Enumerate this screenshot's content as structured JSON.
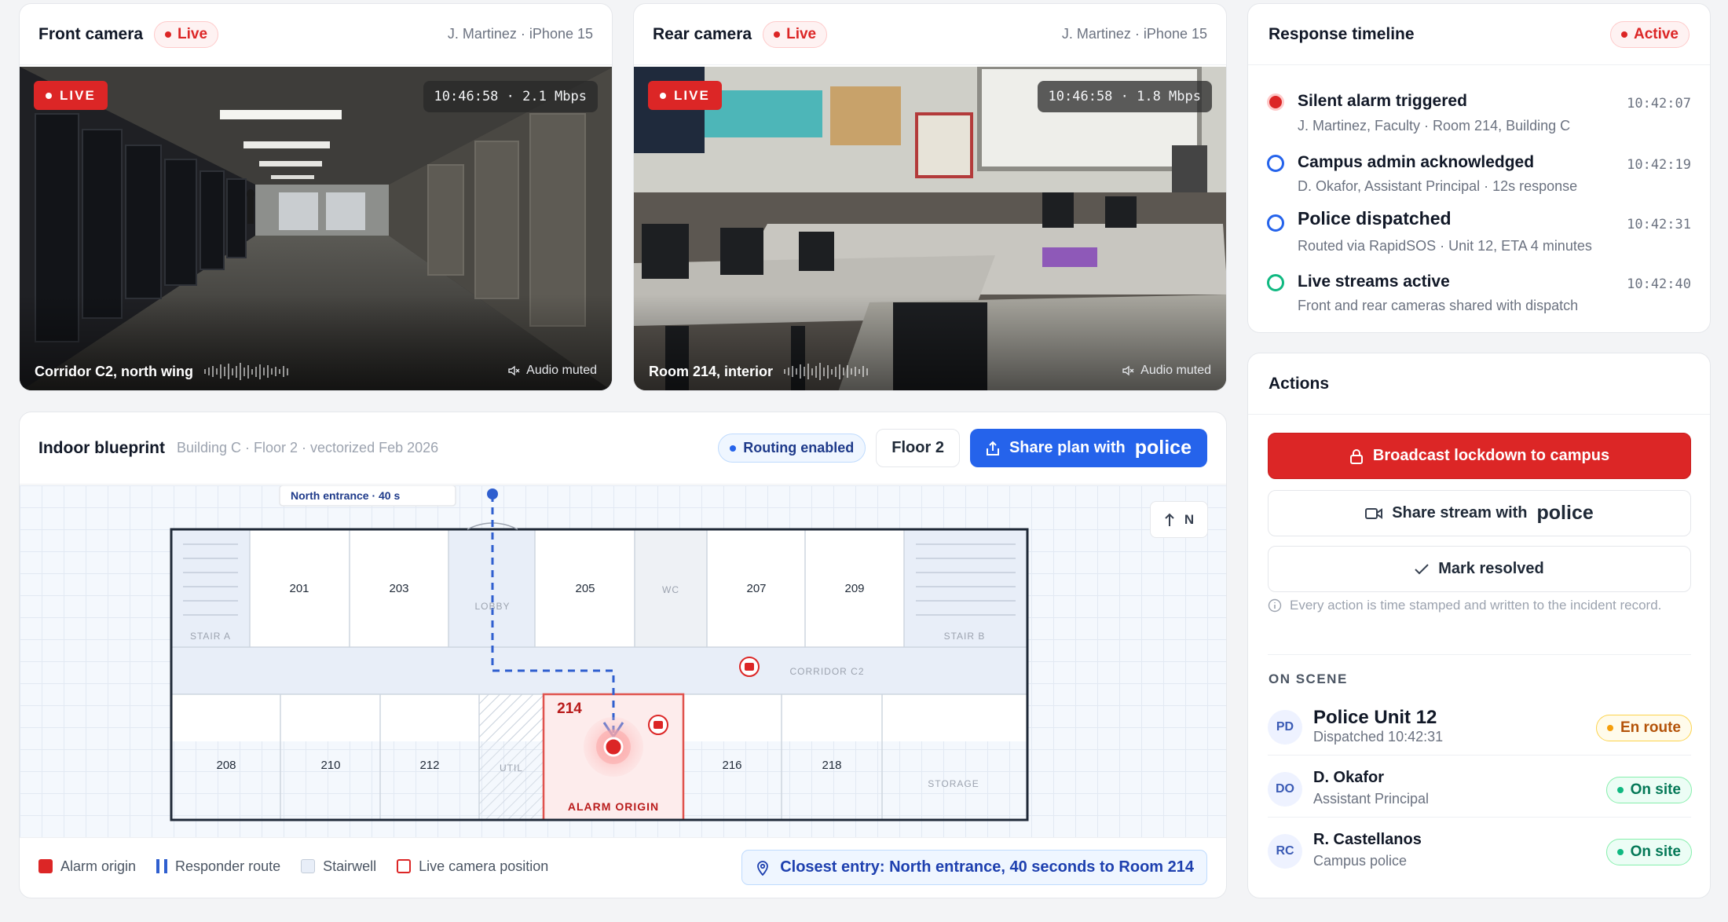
{
  "front_camera": {
    "title": "Front camera",
    "status": "Live",
    "owner": "J. Martinez · iPhone 15",
    "badge": "LIVE",
    "stats": "10:46:58 · 2.1 Mbps",
    "caption": "Corridor C2, north wing",
    "audio": "Audio muted"
  },
  "rear_camera": {
    "title": "Rear camera",
    "status": "Live",
    "owner": "J. Martinez · iPhone 15",
    "badge": "LIVE",
    "stats": "10:46:58 · 1.8 Mbps",
    "caption": "Room 214, interior",
    "audio": "Audio muted"
  },
  "timeline": {
    "title": "Response timeline",
    "status": "Active",
    "events": [
      {
        "title": "Silent alarm triggered",
        "detail": "J. Martinez, Faculty · Room 214, Building C",
        "time": "10:42:07",
        "marker": "#dc2626"
      },
      {
        "title": "Campus admin acknowledged",
        "detail": "D. Okafor, Assistant Principal · 12s response",
        "time": "10:42:19",
        "marker": "#2563eb"
      },
      {
        "title": "Police dispatched",
        "detail": "Routed via RapidSOS · Unit 12, ETA 4 minutes",
        "time": "10:42:31",
        "marker": "#2563eb"
      },
      {
        "title": "Live streams active",
        "detail": "Front and rear cameras shared with dispatch",
        "time": "10:42:40",
        "marker": "#10b981"
      }
    ]
  },
  "actions": {
    "title": "Actions",
    "lockdown": "Broadcast lockdown to campus",
    "share_stream": "Share stream with",
    "share_stream_target": "police",
    "resolve": "Mark resolved",
    "note": "Every action is time stamped and written to the incident record.",
    "on_scene_label": "ON SCENE",
    "people": [
      {
        "initials": "PD",
        "name": "Police Unit 12",
        "role": "Dispatched 10:42:31",
        "status": "En route",
        "tone": "amber"
      },
      {
        "initials": "DO",
        "name": "D. Okafor",
        "role": "Assistant Principal",
        "status": "On site",
        "tone": "green"
      },
      {
        "initials": "RC",
        "name": "R. Castellanos",
        "role": "Campus police",
        "status": "On site",
        "tone": "green"
      }
    ]
  },
  "blueprint": {
    "title": "Indoor blueprint",
    "subtitle": "Building C · Floor 2 · vectorized Feb 2026",
    "routing": "Routing enabled",
    "floor": "Floor 2",
    "share": "Share plan with",
    "share_target": "police",
    "compass": "N",
    "entrance_label": "North entrance · 40 s",
    "rooms_top": [
      "201",
      "203",
      "205",
      "207",
      "209"
    ],
    "rooms_bottom": [
      "208",
      "210",
      "212",
      "216",
      "218"
    ],
    "labels": {
      "stair_a": "STAIR A",
      "stair_b": "STAIR B",
      "lobby": "LOBBY",
      "wc": "WC",
      "corridor": "CORRIDOR C2",
      "util": "UTIL",
      "storage": "STORAGE",
      "alarm_room": "214",
      "alarm_label": "ALARM ORIGIN"
    },
    "legend": {
      "alarm": "Alarm origin",
      "route": "Responder route",
      "stairwell": "Stairwell",
      "camera": "Live camera position"
    },
    "closest": "Closest entry: North entrance, 40 seconds to Room 214"
  }
}
